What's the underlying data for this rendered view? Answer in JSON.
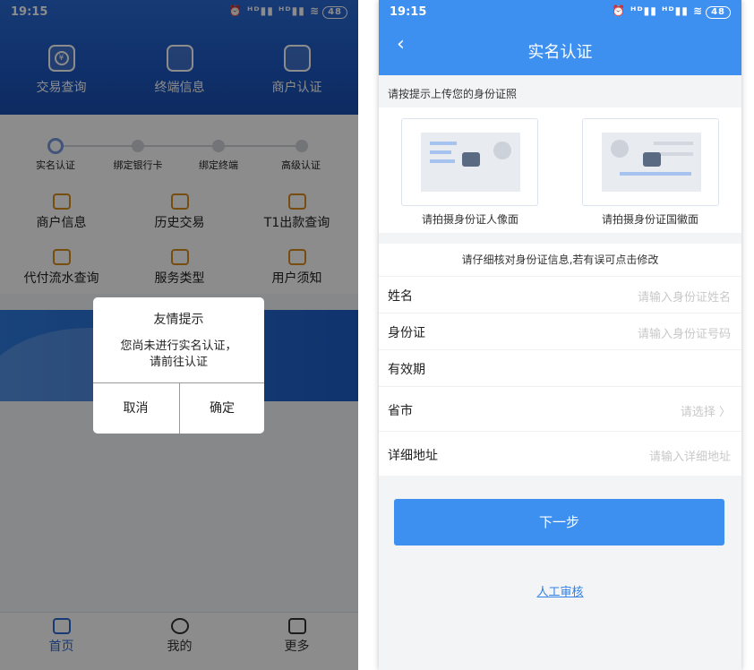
{
  "status": {
    "time": "19:15",
    "battery": "48",
    "icons": "⏰ ᴴᴰ▮▮ ᴴᴰ▮▮ ≋"
  },
  "left": {
    "quick": [
      {
        "label": "交易查询",
        "icon": "yen-icon"
      },
      {
        "label": "终端信息",
        "icon": "terminal-icon"
      },
      {
        "label": "商户认证",
        "icon": "merchant-verify-icon"
      }
    ],
    "steps": [
      "实名认证",
      "绑定银行卡",
      "绑定终端",
      "高级认证"
    ],
    "grid": [
      {
        "label": "商户信息",
        "icon": "shop-icon"
      },
      {
        "label": "历史交易",
        "icon": "history-icon"
      },
      {
        "label": "T1出款查询",
        "icon": "t1-icon"
      },
      {
        "label": "代付流水查询",
        "icon": "payment-icon"
      },
      {
        "label": "服务类型",
        "icon": "layers-icon"
      },
      {
        "label": "用户须知",
        "icon": "notice-icon"
      }
    ],
    "dialog": {
      "title": "友情提示",
      "message_line1": "您尚未进行实名认证，",
      "message_line2": "请前往认证",
      "cancel": "取消",
      "confirm": "确定"
    },
    "tabs": [
      {
        "label": "首页",
        "icon": "home-icon"
      },
      {
        "label": "我的",
        "icon": "user-icon"
      },
      {
        "label": "更多",
        "icon": "more-icon"
      }
    ]
  },
  "right": {
    "title": "实名认证",
    "upload_hint": "请按提示上传您的身份证照",
    "front_caption": "请拍摄身份证人像面",
    "back_caption": "请拍摄身份证国徽面",
    "verify_hint": "请仔细核对身份证信息,若有误可点击修改",
    "fields": {
      "name_label": "姓名",
      "name_placeholder": "请输入身份证姓名",
      "id_label": "身份证",
      "id_placeholder": "请输入身份证号码",
      "validity_label": "有效期",
      "city_label": "省市",
      "city_placeholder": "请选择 〉",
      "address_label": "详细地址",
      "address_placeholder": "请输入详细地址"
    },
    "next": "下一步",
    "manual": "人工审核"
  },
  "colors": {
    "left_header": "#1d58c2",
    "right_header": "#3d8ff0",
    "accent": "#2f80e6"
  }
}
